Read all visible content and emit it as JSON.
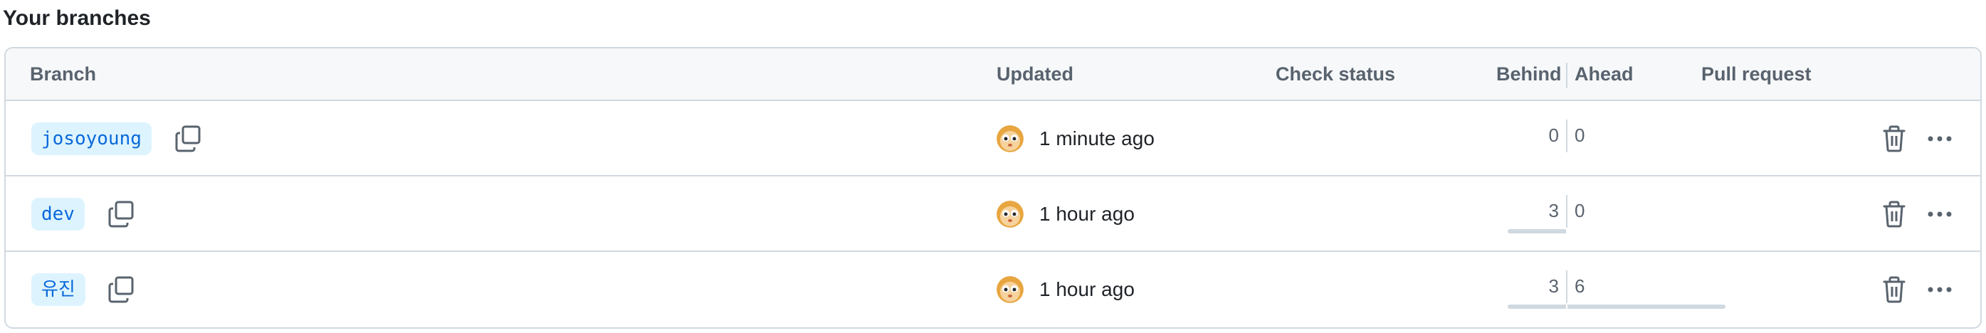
{
  "section": {
    "title": "Your branches"
  },
  "table": {
    "headers": {
      "branch": "Branch",
      "updated": "Updated",
      "check_status": "Check status",
      "behind": "Behind",
      "ahead": "Ahead",
      "pull_request": "Pull request"
    },
    "rows": [
      {
        "name": "josoyoung",
        "updated": "1 minute ago",
        "behind": "0",
        "ahead": "0",
        "behind_fraction": 0,
        "ahead_fraction": 0
      },
      {
        "name": "dev",
        "updated": "1 hour ago",
        "behind": "3",
        "ahead": "0",
        "behind_fraction": 0.5,
        "ahead_fraction": 0
      },
      {
        "name": "유진",
        "updated": "1 hour ago",
        "behind": "3",
        "ahead": "6",
        "behind_fraction": 0.5,
        "ahead_fraction": 1
      }
    ]
  },
  "icons": {
    "copy": "copy-icon",
    "delete": "trash-icon",
    "more": "kebab-horizontal-icon",
    "avatar": "user-avatar"
  },
  "colors": {
    "branch_pill_bg": "#ddf4ff",
    "branch_pill_text": "#0969da",
    "header_bg": "#f6f8fa",
    "border": "#d1d9e0",
    "muted_text": "#59636e"
  }
}
